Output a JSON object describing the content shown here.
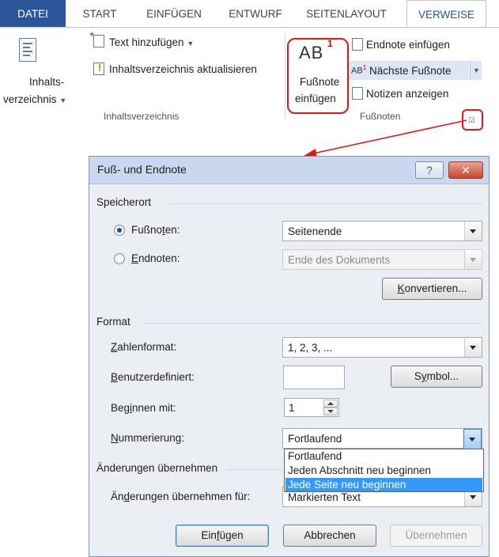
{
  "ribbon": {
    "tabs": [
      {
        "label": "DATEI"
      },
      {
        "label": "START"
      },
      {
        "label": "EINFÜGEN"
      },
      {
        "label": "ENTWURF"
      },
      {
        "label": "SEITENLAYOUT"
      },
      {
        "label": "VERWEISE"
      }
    ],
    "toc": {
      "label_line1": "Inhalts-",
      "label_line2": "verzeichnis",
      "add_text": "Text hinzufügen",
      "update": "Inhaltsverzeichnis aktualisieren",
      "group": "Inhaltsverzeichnis"
    },
    "footnotes": {
      "big_ab": "AB",
      "big_sup": "1",
      "insert_line1": "Fußnote",
      "insert_line2": "einfügen",
      "endnote": "Endnote einfügen",
      "next_ab": "AB",
      "next_sup": "1",
      "next": "Nächste Fußnote",
      "show": "Notizen anzeigen",
      "group": "Fußnoten"
    },
    "colors": {
      "file_tab": "#2b579a",
      "highlight": "#e01818"
    }
  },
  "dialog": {
    "title": "Fuß- und Endnote",
    "help_btn": "?",
    "close_btn": "✕",
    "location": {
      "section": "Speicherort",
      "footnotes_pre": "Fußno",
      "footnotes_u": "t",
      "footnotes_post": "en:",
      "footnotes_value": "Seitenende",
      "endnotes_u": "E",
      "endnotes_post": "ndnoten:",
      "endnotes_value": "Ende des Dokuments",
      "convert_u": "K",
      "convert_post": "onvertieren..."
    },
    "format": {
      "section": "Format",
      "numformat_u": "Z",
      "numformat_post": "ahlenformat:",
      "numformat_value": "1, 2, 3, ...",
      "custom_u": "B",
      "custom_post": "enutzerdefiniert:",
      "custom_value": "",
      "symbol_pre": "S",
      "symbol_u": "y",
      "symbol_post": "mbol...",
      "start_pre": "Beg",
      "start_u": "i",
      "start_post": "nnen mit:",
      "start_value": "1",
      "numbering_u": "N",
      "numbering_post": "ummerierung:",
      "numbering_value": "Fortlaufend",
      "numbering_options": [
        "Fortlaufend",
        "Jeden Abschnitt neu beginnen",
        "Jede Seite neu beginnen"
      ],
      "numbering_selected": "Jede Seite neu beginnen"
    },
    "apply": {
      "section": "Änderungen übernehmen",
      "label_pre": "Än",
      "label_u": "d",
      "label_post": "erungen übernehmen für:",
      "value_partial": "Markierten Text"
    },
    "buttons": {
      "insert_pre": "Ein",
      "insert_u": "f",
      "insert_post": "ügen",
      "cancel": "Abbrechen",
      "apply": "Übernehmen"
    }
  }
}
